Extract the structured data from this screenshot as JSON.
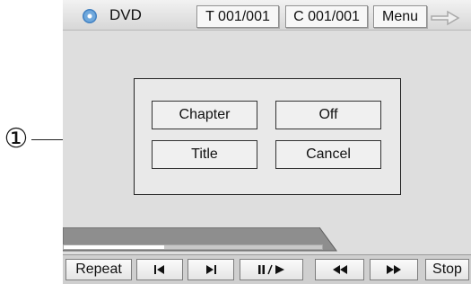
{
  "callout": {
    "number": "①"
  },
  "topbar": {
    "source_label": "DVD",
    "title_counter": "T 001/001",
    "chapter_counter": "C 001/001",
    "menu_label": "Menu",
    "icons": {
      "disc": "disc-icon",
      "forward": "forward-arrow-icon"
    }
  },
  "dialog": {
    "chapter_label": "Chapter",
    "off_label": "Off",
    "title_label": "Title",
    "cancel_label": "Cancel"
  },
  "playback": {
    "progress_fraction": 0.39
  },
  "controls": {
    "repeat_label": "Repeat",
    "prev_icon": "skip-previous-icon",
    "next_icon": "skip-next-icon",
    "play_pause_icon": "play-pause-icon",
    "rewind_icon": "rewind-icon",
    "fast_forward_icon": "fast-forward-icon",
    "stop_label": "Stop"
  },
  "colors": {
    "screen_bg": "#dedede",
    "button_border": "#333333",
    "disc_blue": "#3f7fc1"
  }
}
